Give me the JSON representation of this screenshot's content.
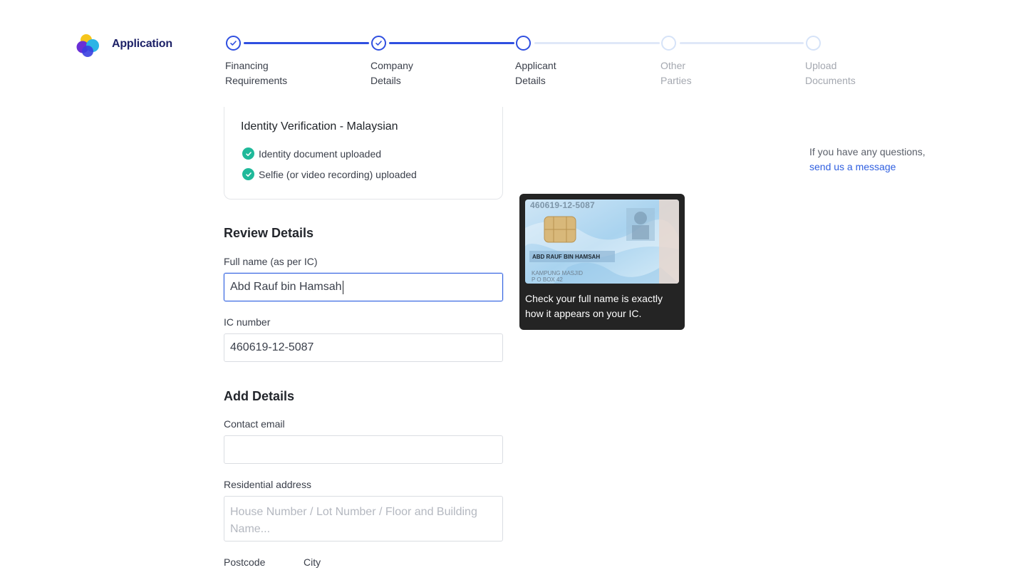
{
  "app": {
    "title": "Application"
  },
  "stepper": {
    "steps": [
      {
        "line1": "Financing",
        "line2": "Requirements",
        "status": "complete"
      },
      {
        "line1": "Company",
        "line2": "Details",
        "status": "complete"
      },
      {
        "line1": "Applicant",
        "line2": "Details",
        "status": "current"
      },
      {
        "line1": "Other",
        "line2": "Parties",
        "status": "upcoming"
      },
      {
        "line1": "Upload",
        "line2": "Documents",
        "status": "upcoming"
      }
    ],
    "colors": {
      "active": "#2f4fe0",
      "inactive": "#d6e3f8"
    }
  },
  "identity": {
    "title": "Identity Verification - Malaysian",
    "items": [
      "Identity document uploaded",
      "Selfie (or video recording) uploaded"
    ],
    "check_color": "#1fb99a"
  },
  "review": {
    "heading": "Review Details",
    "full_name_label": "Full name (as per IC)",
    "full_name_value": "Abd Rauf bin Hamsah",
    "ic_label": "IC number",
    "ic_value": "460619-12-5087"
  },
  "add": {
    "heading": "Add Details",
    "email_label": "Contact email",
    "email_value": "",
    "address_label": "Residential address",
    "address_placeholder": "House Number / Lot Number / Floor and Building Name...",
    "postcode_label": "Postcode",
    "city_label": "City"
  },
  "tooltip": {
    "card_number": "460619-12-5087",
    "card_name": "ABD RAUF BIN HAMSAH",
    "card_address_1": "KAMPUNG MASJID",
    "card_address_2": "P O BOX 42",
    "text": "Check your full name is exactly how it appears on your IC."
  },
  "help": {
    "text": "If you have any questions,",
    "link": "send us a message",
    "link_color": "#2f5fe0"
  }
}
